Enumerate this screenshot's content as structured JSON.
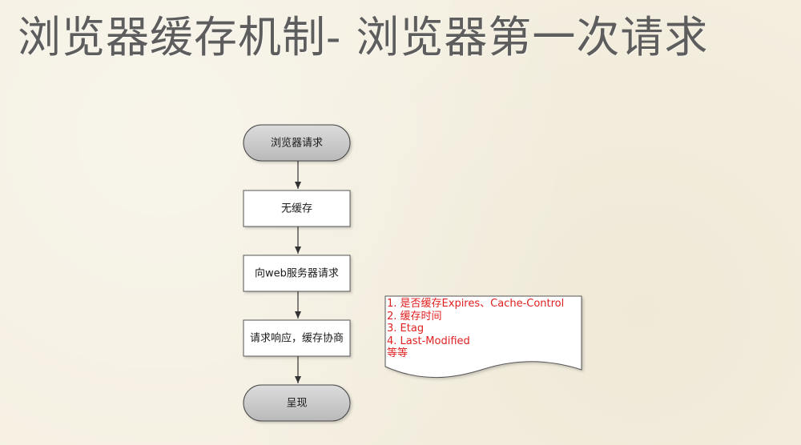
{
  "slide": {
    "title": "浏览器缓存机制-  浏览器第一次请求"
  },
  "flowchart": {
    "nodes": [
      {
        "id": "start",
        "label": "浏览器请求"
      },
      {
        "id": "no-cache",
        "label": "无缓存"
      },
      {
        "id": "request-server",
        "label": "向web服务器请求"
      },
      {
        "id": "response",
        "label": "请求响应，缓存协商"
      },
      {
        "id": "end",
        "label": "呈现"
      }
    ],
    "note": {
      "lines": [
        "1. 是否缓存Expires、Cache-Control",
        "2. 缓存时间",
        "3. Etag",
        "4. Last-Modified",
        "等等"
      ]
    }
  },
  "colors": {
    "background": "#f4efe0",
    "terminal_fill": "#c7c7c7",
    "process_fill": "#ffffff",
    "note_text": "#e02020",
    "title_text": "#5d5d5d"
  }
}
